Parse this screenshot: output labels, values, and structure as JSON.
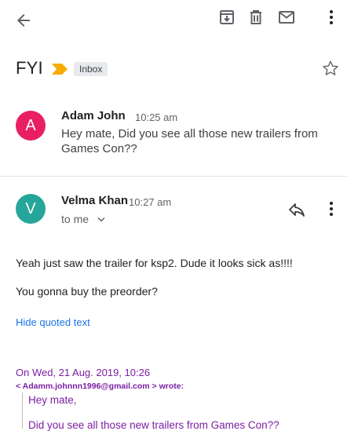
{
  "toolbar": {
    "icons": [
      "back-arrow-icon",
      "archive-icon",
      "delete-icon",
      "mail-icon",
      "more-vert-icon"
    ]
  },
  "thread": {
    "subject": "FYI",
    "label": "Inbox",
    "important_color": "#f9ab00"
  },
  "messages": [
    {
      "avatar_letter": "A",
      "avatar_color": "#e91e63",
      "sender": "Adam John",
      "time": "10:25 am",
      "preview_line1": "Hey mate, Did you see all those new trailers from",
      "preview_line2": "Games Con??"
    },
    {
      "avatar_letter": "V",
      "avatar_color": "#26a69a",
      "sender": "Velma Khan",
      "time": "10:27 am",
      "recipient": "to me",
      "body": [
        "Yeah just saw the trailer for ksp2. Dude it looks sick as!!!!",
        "You gonna buy the preorder?"
      ],
      "hide_quoted": "Hide quoted text",
      "quote": {
        "header": "On Wed, 21 Aug. 2019, 10:26",
        "email": "< Adamm.johnnn1996@gmail.com > wrote:",
        "lines": [
          "Hey mate,",
          "Did you see all those new trailers from Games Con??"
        ]
      }
    }
  ],
  "colors": {
    "link": "#1a73e8",
    "quote": "#7b1fa2"
  }
}
